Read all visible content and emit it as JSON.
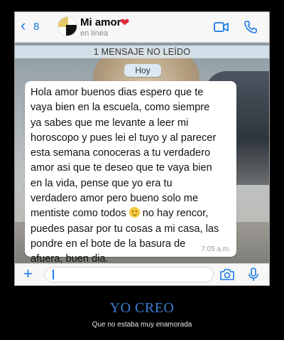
{
  "header": {
    "back_count": "8",
    "contact_name": "Mi amor",
    "status": "en línea"
  },
  "icons": {
    "back": "chevron-left-icon",
    "heart": "heart-icon",
    "video": "video-camera-icon",
    "call": "phone-icon",
    "add": "plus-icon",
    "camera": "camera-icon",
    "mic": "microphone-icon"
  },
  "colors": {
    "accent": "#1a7ae6",
    "heart": "#e0283a",
    "caption_title": "#3a7fd4"
  },
  "chat": {
    "unread_banner": "1 MENSAJE NO LEÍDO",
    "day_label": "Hoy",
    "message": {
      "text_before_emoji": "Hola amor buenos dias espero que te\nvaya bien en la escuela, como siempre\nya sabes que me levante a leer mi\nhoroscopo y pues lei el tuyo y al parecer\nesta semana conoceras a tu verdadero\namor asi que te deseo que te vaya bien\nen la vida, pense que yo era tu\nverdadero amor pero bueno solo me\nmentiste como todos ",
      "emoji": "slightly-smiling-face",
      "text_after_emoji": "  no  hay rencor,\npuedes pasar por tu cosas a mi casa, las\npondre en el bote de la basura de\nafuera, buen dia.",
      "time": "7:05 a.m."
    }
  },
  "caption": {
    "title": "YO CREO",
    "subtitle": "Que no estaba muy enamorada"
  }
}
